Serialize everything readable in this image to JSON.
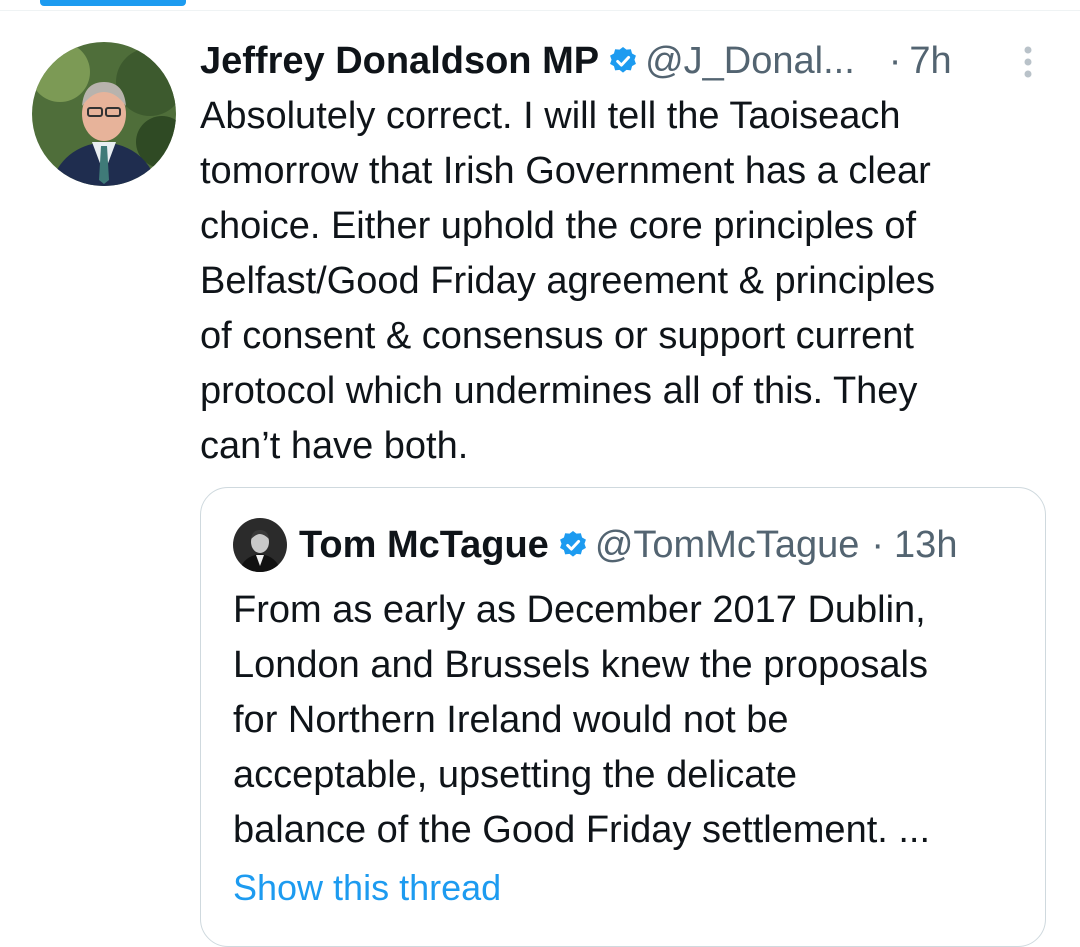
{
  "tweet": {
    "author_name": "Jeffrey Donaldson MP",
    "handle": "@J_Donal...",
    "dot": "·",
    "time": "7h",
    "text": "Absolutely correct. I will tell the Taoiseach\ntomorrow that Irish Government has a clear\nchoice. Either uphold the core principles of\nBelfast/Good Friday agreement & principles\nof consent & consensus or support current\nprotocol which undermines all of this. They\ncan’t have both."
  },
  "quoted_tweet": {
    "author_name": "Tom McTague",
    "handle": "@TomMcTague",
    "dot": "·",
    "time": "13h",
    "text": "From as early as December 2017 Dublin,\nLondon and Brussels knew the proposals\nfor Northern Ireland would not be\nacceptable, upsetting the delicate\nbalance of the Good Friday settlement. ...",
    "show_thread": "Show this thread"
  },
  "icons": {
    "verified": "verified-badge-icon",
    "more": "more-vertical-icon"
  },
  "colors": {
    "accent": "#1d9bf0",
    "secondary_text": "#536471",
    "primary_text": "#0f1419",
    "border": "#cfd9de"
  }
}
